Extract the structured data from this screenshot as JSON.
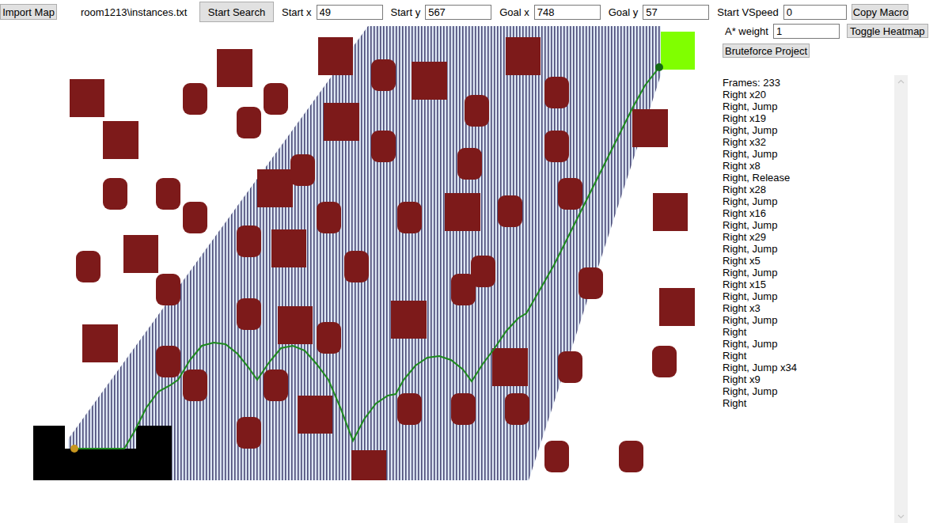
{
  "toolbar": {
    "import_button": "Import Map",
    "file": "room1213\\instances.txt",
    "search_button": "Start Search",
    "fields": [
      {
        "label": "Start x",
        "value": "49"
      },
      {
        "label": "Start y",
        "value": "567"
      },
      {
        "label": "Goal x",
        "value": "748"
      },
      {
        "label": "Goal y",
        "value": "57"
      },
      {
        "label": "Start VSpeed",
        "value": "0"
      }
    ],
    "copy_button": "Copy Macro"
  },
  "options": {
    "weight_label": "A* weight",
    "weight_value": "1",
    "heatmap_button": "Toggle Heatmap",
    "heatmap_on": true,
    "bruteforce_button": "Bruteforce Project"
  },
  "macro": {
    "frames": "Frames: 233",
    "steps": [
      "Right x20",
      "Right, Jump",
      "Right x19",
      "Right, Jump",
      "Right x32",
      "Right, Jump",
      "Right x8",
      "Right, Release",
      "Right x28",
      "Right, Jump",
      "Right x16",
      "Right, Jump",
      "Right x29",
      "Right, Jump",
      "Right x5",
      "Right, Jump",
      "Right x15",
      "Right, Jump",
      "Right x3",
      "Right, Jump",
      "Right",
      "Right, Jump",
      "Right",
      "Right, Jump x34",
      "Right x9",
      "Right, Jump",
      "Right"
    ]
  }
}
